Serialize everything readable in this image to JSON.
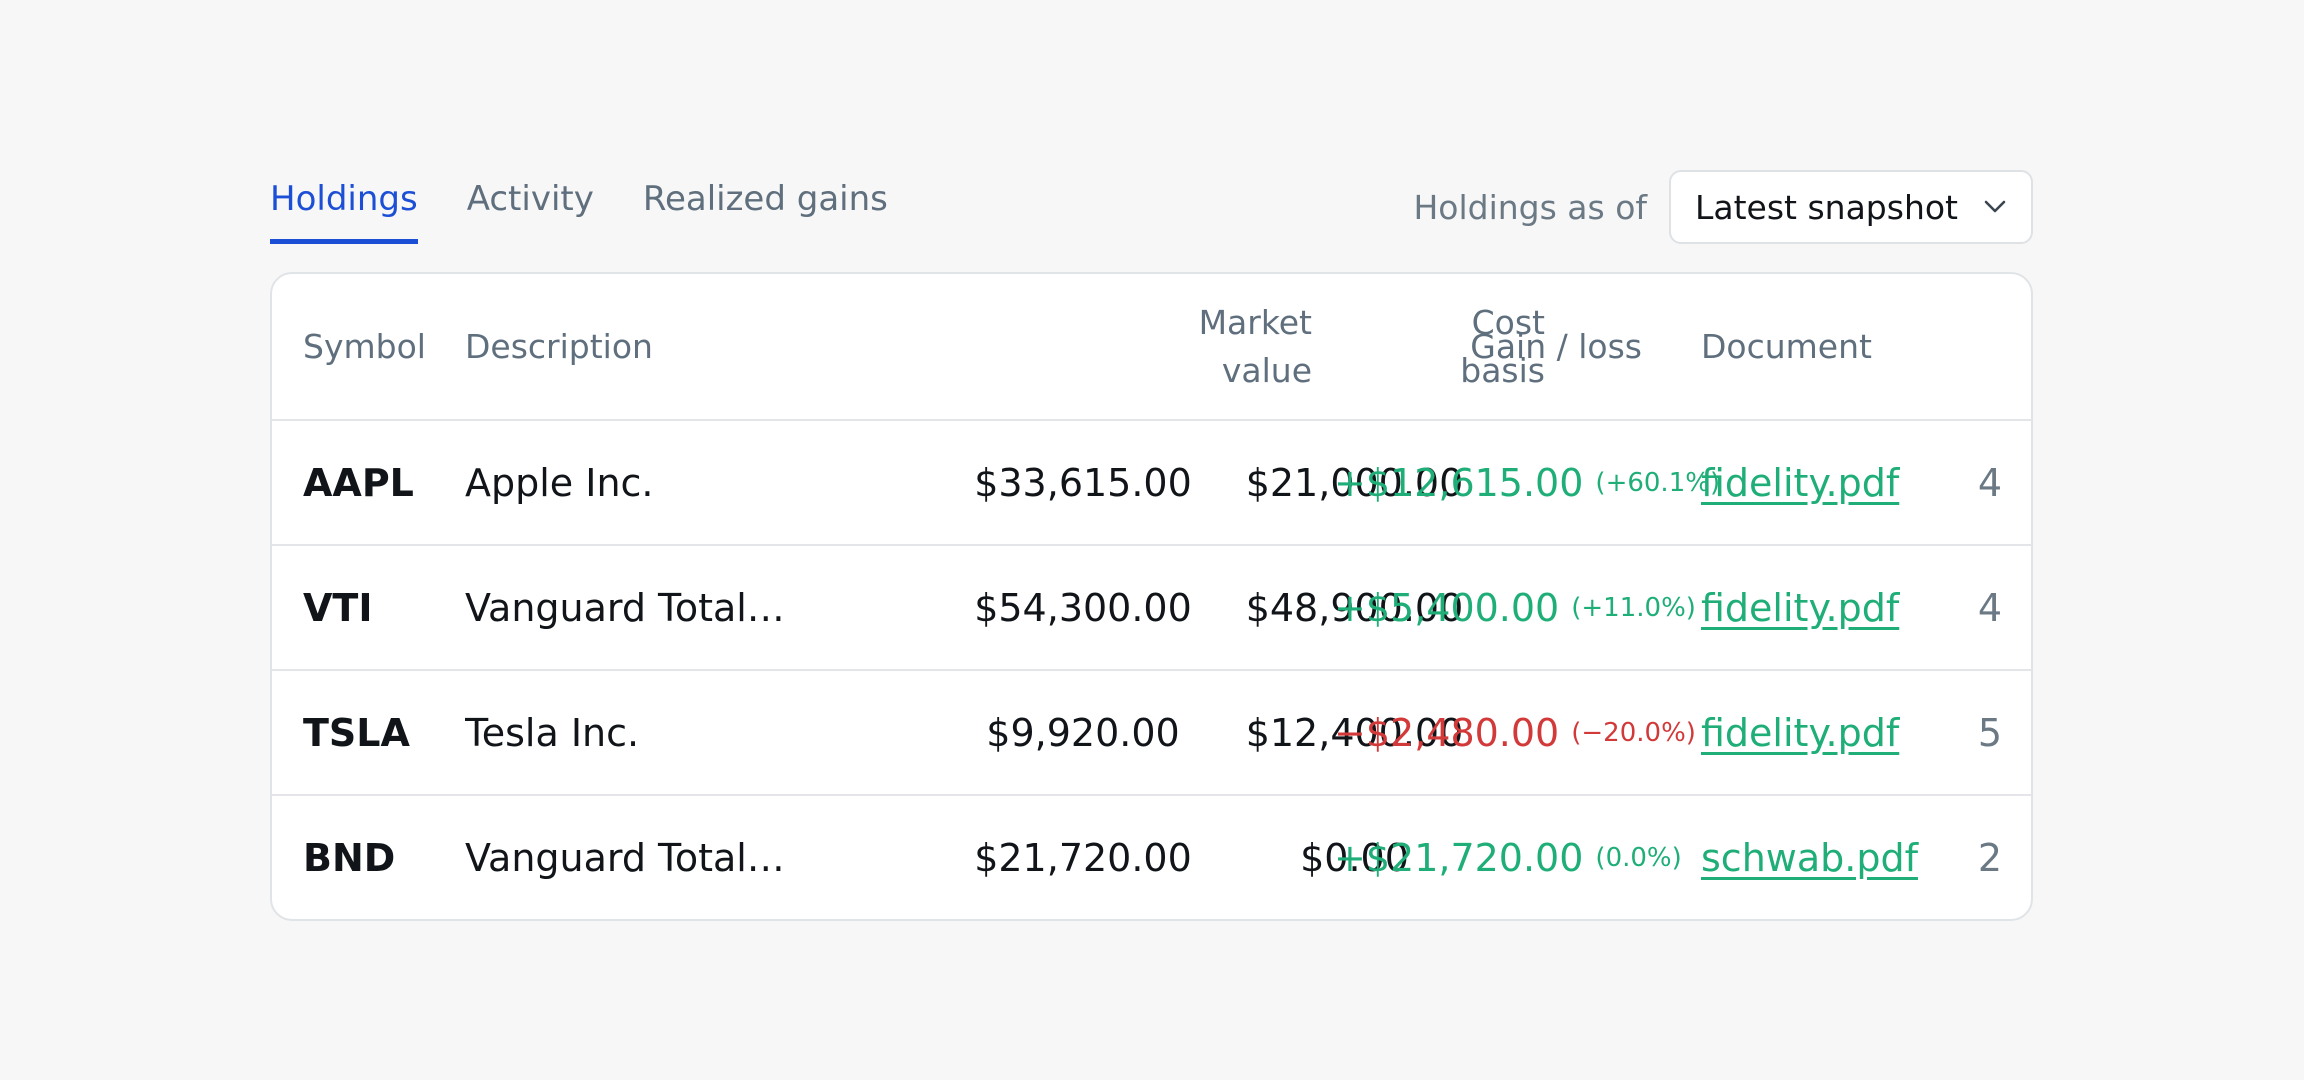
{
  "tabs": [
    {
      "label": "Holdings",
      "active": true
    },
    {
      "label": "Activity",
      "active": false
    },
    {
      "label": "Realized gains",
      "active": false
    }
  ],
  "snapshot": {
    "label": "Holdings as of",
    "selected": "Latest snapshot"
  },
  "table": {
    "headers": {
      "symbol": "Symbol",
      "description": "Description",
      "market_value_1": "Market",
      "market_value_2": "value",
      "cost_basis_1": "Cost",
      "cost_basis_2": "basis",
      "gain_loss": "Gain / loss",
      "document": "Document"
    },
    "rows": [
      {
        "symbol": "AAPL",
        "description": "Apple Inc.",
        "market_value": "$33,615.00",
        "cost_basis": "$21,000.00",
        "gain": "+$12,615.00",
        "gain_pct": "(+60.1%)",
        "direction": "pos",
        "document": "fidelity.pdf",
        "count": "4"
      },
      {
        "symbol": "VTI",
        "description": "Vanguard Total…",
        "market_value": "$54,300.00",
        "cost_basis": "$48,900.00",
        "gain": "+$5,400.00",
        "gain_pct": "(+11.0%)",
        "direction": "pos",
        "document": "fidelity.pdf",
        "count": "4"
      },
      {
        "symbol": "TSLA",
        "description": "Tesla Inc.",
        "market_value": "$9,920.00",
        "cost_basis": "$12,400.00",
        "gain": "−$2,480.00",
        "gain_pct": "(−20.0%)",
        "direction": "neg",
        "document": "fidelity.pdf",
        "count": "5"
      },
      {
        "symbol": "BND",
        "description": "Vanguard Total…",
        "market_value": "$21,720.00",
        "cost_basis": "$0.00",
        "gain": "+$21,720.00",
        "gain_pct": "(0.0%)",
        "direction": "pos",
        "document": "schwab.pdf",
        "count": "2"
      }
    ]
  },
  "colors": {
    "accent": "#1c4fd6",
    "positive": "#1fae78",
    "negative": "#d23a3a",
    "muted": "#5f6f7d"
  },
  "icons": {
    "dropdown": "chevron-down-icon"
  }
}
